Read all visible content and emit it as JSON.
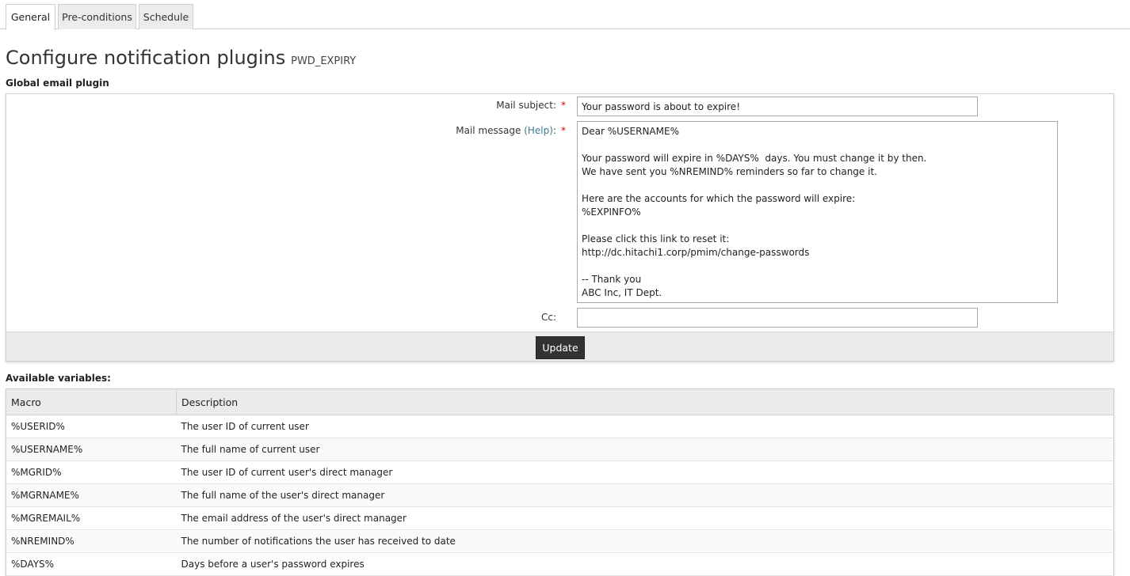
{
  "tabs": [
    {
      "label": "General",
      "active": true
    },
    {
      "label": "Pre-conditions",
      "active": false
    },
    {
      "label": "Schedule",
      "active": false
    }
  ],
  "page": {
    "title": "Configure notification plugins",
    "subtitle": "PWD_EXPIRY"
  },
  "form": {
    "section_label": "Global email plugin",
    "subject_label": "Mail subject:",
    "subject_value": "Your password is about to expire!",
    "message_label": "Mail message",
    "help_link": "(Help)",
    "message_colon": ":",
    "required_mark": "*",
    "message_value": "Dear %USERNAME%\n\nYour password will expire in %DAYS%  days. You must change it by then.\nWe have sent you %NREMIND% reminders so far to change it.\n\nHere are the accounts for which the password will expire:\n%EXPINFO%\n\nPlease click this link to reset it:\nhttp://dc.hitachi1.corp/pmim/change-passwords\n\n-- Thank you\nABC Inc, IT Dept.",
    "cc_label": "Cc:",
    "cc_value": "",
    "update_label": "Update"
  },
  "variables": {
    "section_label": "Available variables:",
    "columns": [
      "Macro",
      "Description"
    ],
    "rows": [
      [
        "%USERID%",
        "The user ID of current user"
      ],
      [
        "%USERNAME%",
        "The full name of current user"
      ],
      [
        "%MGRID%",
        "The user ID of current user's direct manager"
      ],
      [
        "%MGRNAME%",
        "The full name of the user's direct manager"
      ],
      [
        "%MGREMAIL%",
        "The email address of the user's direct manager"
      ],
      [
        "%NREMIND%",
        "The number of notifications the user has received to date"
      ],
      [
        "%DAYS%",
        "Days before a user's password expires"
      ]
    ]
  },
  "colors": {
    "button_bg": "#333333",
    "required": "#cc0000",
    "help_link": "#3a7a8c",
    "panel_bar": "#ebebeb"
  }
}
